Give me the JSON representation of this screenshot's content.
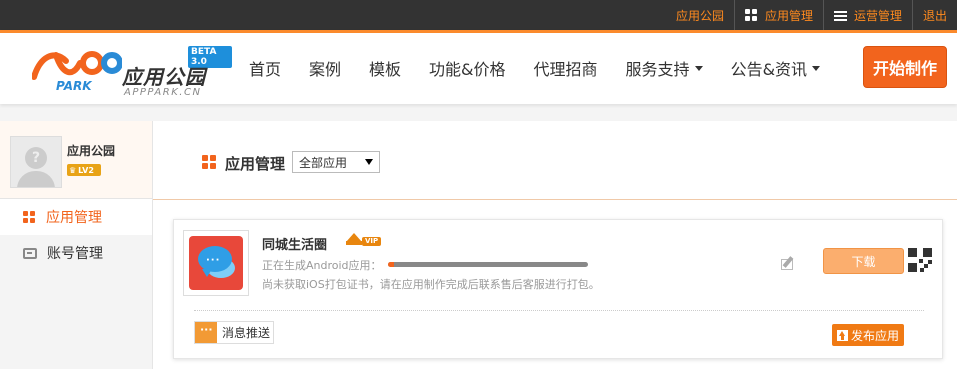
{
  "topbar": {
    "items": [
      {
        "label": "应用公园",
        "icon": ""
      },
      {
        "label": "应用管理",
        "icon": "grid-icon"
      },
      {
        "label": "运营管理",
        "icon": "list-icon"
      },
      {
        "label": "退出",
        "icon": ""
      }
    ]
  },
  "header": {
    "logo": {
      "brand": "应用公园",
      "domain": "APPPARK.CN",
      "beta": "BETA 3.0"
    },
    "nav": [
      {
        "label": "首页"
      },
      {
        "label": "案例"
      },
      {
        "label": "模板"
      },
      {
        "label": "功能&价格"
      },
      {
        "label": "代理招商"
      },
      {
        "label": "服务支持",
        "dropdown": true
      },
      {
        "label": "公告&资讯",
        "dropdown": true
      }
    ],
    "start_button": "开始制作"
  },
  "sidebar": {
    "username": "应用公园",
    "level": "LV2",
    "menu": [
      {
        "label": "应用管理",
        "icon": "grid-icon",
        "active": true
      },
      {
        "label": "账号管理",
        "icon": "account-icon",
        "active": false
      }
    ]
  },
  "main": {
    "title": "应用管理",
    "filter": {
      "selected": "全部应用"
    },
    "app_card": {
      "name": "同城生活圈",
      "badge": "VIP",
      "status_text": "正在生成Android应用：",
      "progress": 0.03,
      "ios_note": "尚未获取iOS打包证书，请在应用制作完成后联系售后客服进行打包。",
      "download_label": "下载",
      "push_label": "消息推送",
      "publish_label": "发布应用"
    }
  },
  "colors": {
    "accent": "#f2641d",
    "topbar_bg": "#333333",
    "topbar_text": "#ff8a1e"
  }
}
